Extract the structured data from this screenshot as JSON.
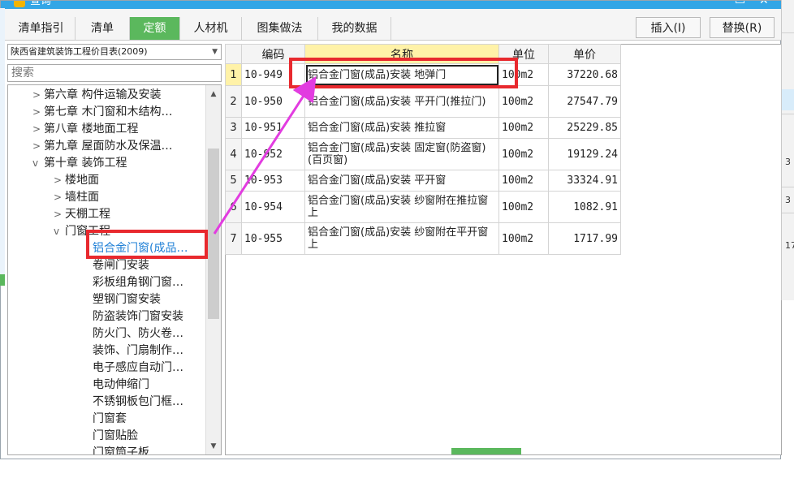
{
  "window": {
    "title": "查询",
    "minimize_glyph": "▭",
    "close_glyph": "✕"
  },
  "tabs": [
    {
      "label": "清单指引",
      "active": false
    },
    {
      "label": "清单",
      "active": false
    },
    {
      "label": "定额",
      "active": true
    },
    {
      "label": "人材机",
      "active": false
    },
    {
      "label": "图集做法",
      "active": false
    },
    {
      "label": "我的数据",
      "active": false
    }
  ],
  "toolbar": {
    "insert_label": "插入(I)",
    "replace_label": "替换(R)"
  },
  "left_panel": {
    "catalog_selected": "陕西省建筑装饰工程价目表(2009)",
    "search_placeholder": "搜索",
    "tree": [
      {
        "label": "第六章 构件运输及安装",
        "chev": ">"
      },
      {
        "label": "第七章 木门窗和木结构…",
        "chev": ">"
      },
      {
        "label": "第八章 楼地面工程",
        "chev": ">"
      },
      {
        "label": "第九章 屋面防水及保温…",
        "chev": ">"
      },
      {
        "label": "第十章 装饰工程",
        "chev": "v"
      },
      {
        "label": "楼地面",
        "chev": ">"
      },
      {
        "label": "墙柱面",
        "chev": ">"
      },
      {
        "label": "天棚工程",
        "chev": ">"
      },
      {
        "label": "门窗工程",
        "chev": "v"
      },
      {
        "label": "铝合金门窗(成品…",
        "chev": ""
      },
      {
        "label": "卷闸门安装",
        "chev": ""
      },
      {
        "label": "彩板组角钢门窗…",
        "chev": ""
      },
      {
        "label": "塑钢门窗安装",
        "chev": ""
      },
      {
        "label": "防盗装饰门窗安装",
        "chev": ""
      },
      {
        "label": "防火门、防火卷…",
        "chev": ""
      },
      {
        "label": "装饰、门扇制作…",
        "chev": ""
      },
      {
        "label": "电子感应自动门…",
        "chev": ""
      },
      {
        "label": "电动伸缩门",
        "chev": ""
      },
      {
        "label": "不锈钢板包门框…",
        "chev": ""
      },
      {
        "label": "门窗套",
        "chev": ""
      },
      {
        "label": "门窗贴脸",
        "chev": ""
      },
      {
        "label": "门窗筒子板",
        "chev": ""
      }
    ]
  },
  "grid": {
    "headers": {
      "code": "编码",
      "name": "名称",
      "unit": "单位",
      "price": "单价"
    },
    "rows": [
      {
        "idx": "1",
        "code": "10-949",
        "name": "铝合金门窗(成品)安装 地弹门",
        "unit": "100m2",
        "price": "37220.68"
      },
      {
        "idx": "2",
        "code": "10-950",
        "name": "铝合金门窗(成品)安装 平开门(推拉门)",
        "unit": "100m2",
        "price": "27547.79"
      },
      {
        "idx": "3",
        "code": "10-951",
        "name": "铝合金门窗(成品)安装 推拉窗",
        "unit": "100m2",
        "price": "25229.85"
      },
      {
        "idx": "4",
        "code": "10-952",
        "name": "铝合金门窗(成品)安装 固定窗(防盗窗)(百页窗)",
        "unit": "100m2",
        "price": "19129.24"
      },
      {
        "idx": "5",
        "code": "10-953",
        "name": "铝合金门窗(成品)安装 平开窗",
        "unit": "100m2",
        "price": "33324.91"
      },
      {
        "idx": "6",
        "code": "10-954",
        "name": "铝合金门窗(成品)安装 纱窗附在推拉窗上",
        "unit": "100m2",
        "price": "1082.91"
      },
      {
        "idx": "7",
        "code": "10-955",
        "name": "铝合金门窗(成品)安装 纱窗附在平开窗上",
        "unit": "100m2",
        "price": "1717.99"
      }
    ]
  },
  "right_strip": {
    "numbers": [
      "3",
      "3",
      "17"
    ]
  },
  "annotation": {
    "arrow_color": "#e23ce0",
    "box_color": "#e8292e"
  }
}
